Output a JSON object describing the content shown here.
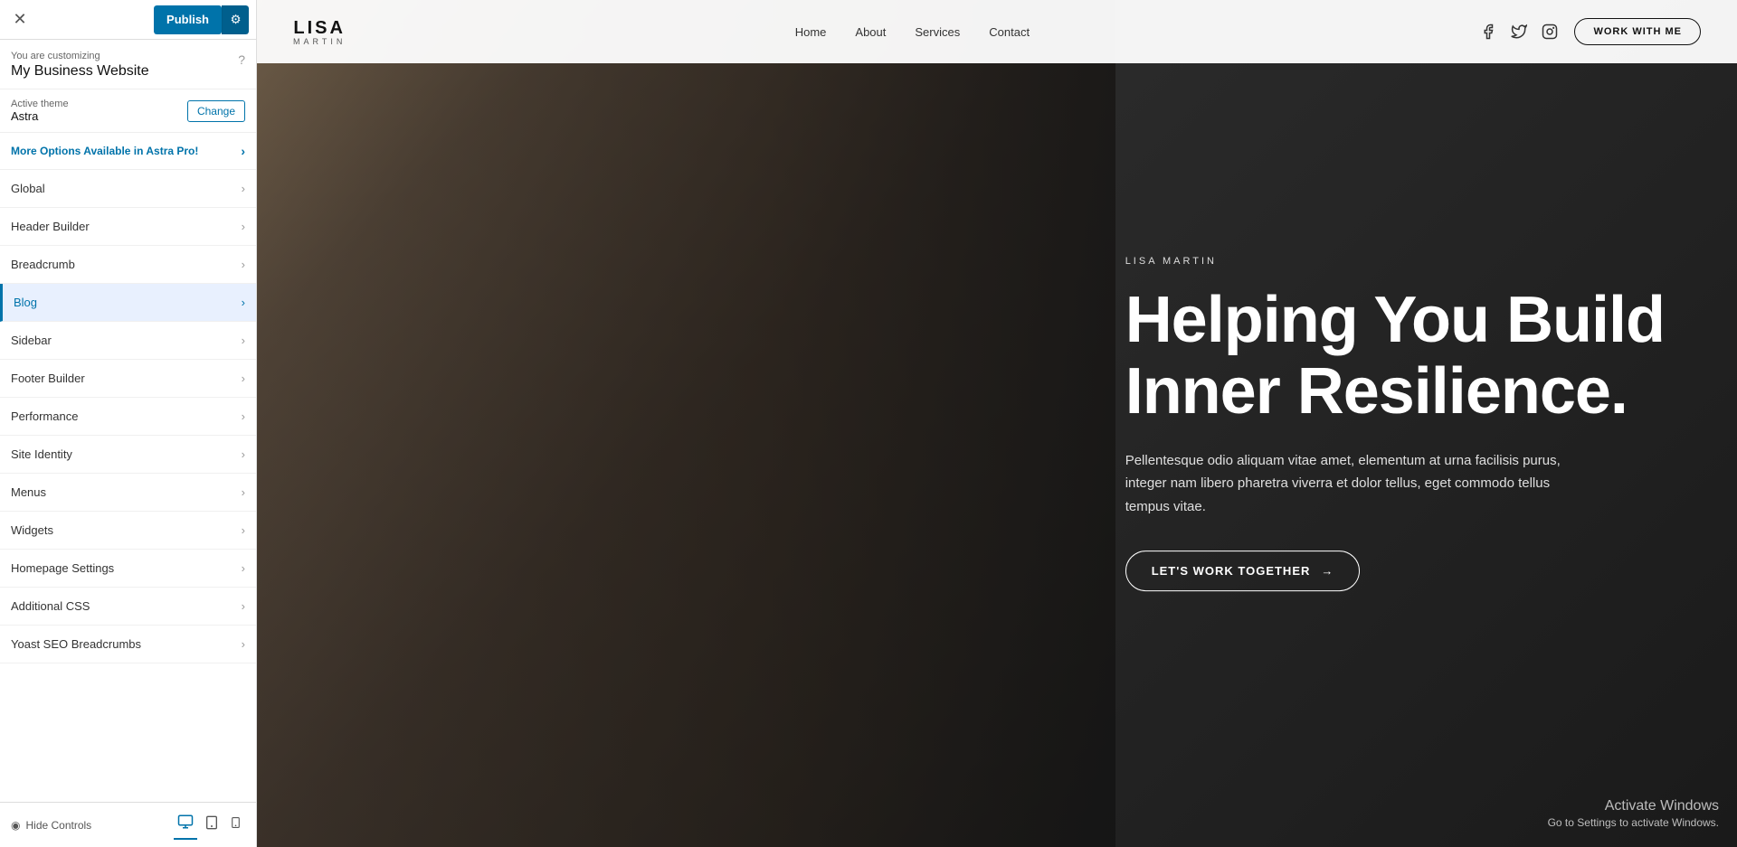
{
  "topbar": {
    "close_label": "✕",
    "publish_label": "Publish",
    "settings_icon": "⚙"
  },
  "customizing": {
    "label": "You are customizing",
    "title": "My Business Website",
    "help_icon": "?"
  },
  "theme": {
    "label": "Active theme",
    "name": "Astra",
    "change_label": "Change"
  },
  "astra_pro": {
    "label": "More Options Available in Astra Pro!",
    "chevron": "›"
  },
  "menu_items": [
    {
      "id": "global",
      "label": "Global",
      "active": false
    },
    {
      "id": "header-builder",
      "label": "Header Builder",
      "active": false
    },
    {
      "id": "breadcrumb",
      "label": "Breadcrumb",
      "active": false
    },
    {
      "id": "blog",
      "label": "Blog",
      "active": true
    },
    {
      "id": "sidebar",
      "label": "Sidebar",
      "active": false
    },
    {
      "id": "footer-builder",
      "label": "Footer Builder",
      "active": false
    },
    {
      "id": "performance",
      "label": "Performance",
      "active": false
    },
    {
      "id": "site-identity",
      "label": "Site Identity",
      "active": false
    },
    {
      "id": "menus",
      "label": "Menus",
      "active": false
    },
    {
      "id": "widgets",
      "label": "Widgets",
      "active": false
    },
    {
      "id": "homepage-settings",
      "label": "Homepage Settings",
      "active": false
    },
    {
      "id": "additional-css",
      "label": "Additional CSS",
      "active": false
    },
    {
      "id": "yoast-seo",
      "label": "Yoast SEO Breadcrumbs",
      "active": false
    }
  ],
  "bottom_bar": {
    "hide_label": "Hide Controls",
    "hide_icon": "◉",
    "device_desktop": "🖥",
    "device_tablet": "⬜",
    "device_mobile": "📱"
  },
  "site": {
    "logo_name": "LISA",
    "logo_sub": "MARTIN",
    "nav": [
      "Home",
      "About",
      "Services",
      "Contact"
    ],
    "social": [
      "f",
      "t",
      "i"
    ],
    "work_with_me": "WORK WITH ME"
  },
  "hero": {
    "subtitle": "LISA MARTIN",
    "title_line1": "Helping You Build",
    "title_line2": "Inner Resilience.",
    "description": "Pellentesque odio aliquam vitae amet, elementum at urna facilisis purus, integer nam libero pharetra viverra et dolor tellus, eget commodo tellus tempus vitae.",
    "cta": "LET'S WORK TOGETHER",
    "cta_arrow": "→"
  },
  "windows": {
    "title": "Activate Windows",
    "desc": "Go to Settings to activate Windows."
  }
}
